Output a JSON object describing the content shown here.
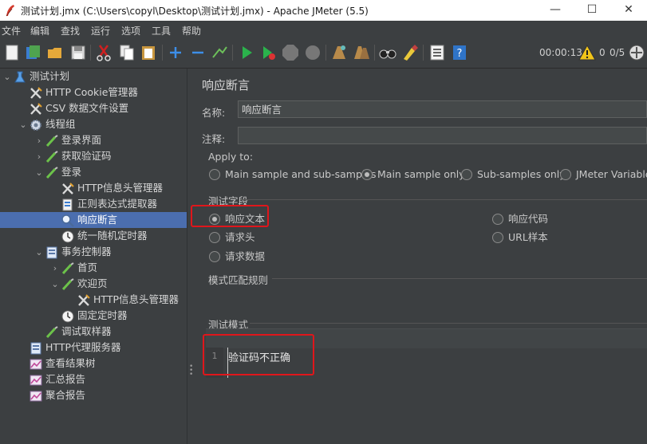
{
  "window": {
    "title": "测试计划.jmx (C:\\Users\\copyl\\Desktop\\测试计划.jmx) - Apache JMeter (5.5)",
    "controls": [
      "—",
      "☐",
      "✕"
    ]
  },
  "menu": [
    "文件",
    "编辑",
    "查找",
    "运行",
    "选项",
    "工具",
    "帮助"
  ],
  "toolbar": {
    "icons": [
      "new-icon",
      "templates-icon",
      "open-icon",
      "save-icon",
      "cut-icon",
      "copy-icon",
      "paste-icon",
      "expand-icon",
      "collapse-icon",
      "toggle-icon",
      "start-icon",
      "start-no-pause-icon",
      "stop-icon",
      "shutdown-icon",
      "clear-icon",
      "clear-all-icon",
      "search-icon",
      "reset-search-icon",
      "function-helper-icon",
      "help-icon"
    ],
    "elapsed": "00:00:13",
    "warning_count": "0",
    "threads": "0/5"
  },
  "tree": [
    {
      "label": "测试计划",
      "level": 0,
      "toggle": "⌄",
      "icon": "test-plan-icon"
    },
    {
      "label": "HTTP Cookie管理器",
      "level": 1,
      "toggle": "",
      "icon": "config-icon"
    },
    {
      "label": "CSV 数据文件设置",
      "level": 1,
      "toggle": "",
      "icon": "config-icon"
    },
    {
      "label": "线程组",
      "level": 1,
      "toggle": "⌄",
      "icon": "thread-group-icon"
    },
    {
      "label": "登录界面",
      "level": 2,
      "toggle": "›",
      "icon": "sampler-icon"
    },
    {
      "label": "获取验证码",
      "level": 2,
      "toggle": "›",
      "icon": "sampler-icon"
    },
    {
      "label": "登录",
      "level": 2,
      "toggle": "⌄",
      "icon": "sampler-icon"
    },
    {
      "label": "HTTP信息头管理器",
      "level": 3,
      "toggle": "",
      "icon": "config-icon"
    },
    {
      "label": "正则表达式提取器",
      "level": 3,
      "toggle": "",
      "icon": "extractor-icon"
    },
    {
      "label": "响应断言",
      "level": 3,
      "toggle": "",
      "icon": "assertion-icon",
      "selected": true
    },
    {
      "label": "统一随机定时器",
      "level": 3,
      "toggle": "",
      "icon": "timer-icon"
    },
    {
      "label": "事务控制器",
      "level": 2,
      "toggle": "⌄",
      "icon": "controller-icon"
    },
    {
      "label": "首页",
      "level": 3,
      "toggle": "›",
      "icon": "sampler-icon"
    },
    {
      "label": "欢迎页",
      "level": 3,
      "toggle": "⌄",
      "icon": "sampler-icon"
    },
    {
      "label": "HTTP信息头管理器",
      "level": 4,
      "toggle": "",
      "icon": "config-icon"
    },
    {
      "label": "固定定时器",
      "level": 3,
      "toggle": "",
      "icon": "timer-icon"
    },
    {
      "label": "调试取样器",
      "level": 2,
      "toggle": "",
      "icon": "sampler-icon"
    },
    {
      "label": "HTTP代理服务器",
      "level": 1,
      "toggle": "",
      "icon": "controller-icon"
    },
    {
      "label": "查看结果树",
      "level": 1,
      "toggle": "",
      "icon": "listener-icon"
    },
    {
      "label": "汇总报告",
      "level": 1,
      "toggle": "",
      "icon": "listener-icon"
    },
    {
      "label": "聚合报告",
      "level": 1,
      "toggle": "",
      "icon": "listener-icon"
    }
  ],
  "panel": {
    "title": "响应断言",
    "name_label": "名称:",
    "name_value": "响应断言",
    "comment_label": "注释:",
    "comment_value": "",
    "apply_to_label": "Apply to:",
    "apply_to_options": [
      {
        "label": "Main sample and sub-samples",
        "checked": false
      },
      {
        "label": "Main sample only",
        "checked": true
      },
      {
        "label": "Sub-samples only",
        "checked": false
      },
      {
        "label": "JMeter Variable N",
        "checked": false
      }
    ],
    "field_to_test_label": "测试字段",
    "field_options": {
      "response_text": {
        "label": "响应文本",
        "checked": true
      },
      "response_code": {
        "label": "响应代码",
        "checked": false
      },
      "request_headers": {
        "label": "请求头",
        "checked": false
      },
      "url_sample": {
        "label": "URL样本",
        "checked": false
      },
      "request_data": {
        "label": "请求数据",
        "checked": false
      }
    },
    "pattern_rules_label": "模式匹配规则",
    "patterns_label": "测试模式",
    "pattern_line_number": "1",
    "pattern_text": "验证码不正确"
  }
}
